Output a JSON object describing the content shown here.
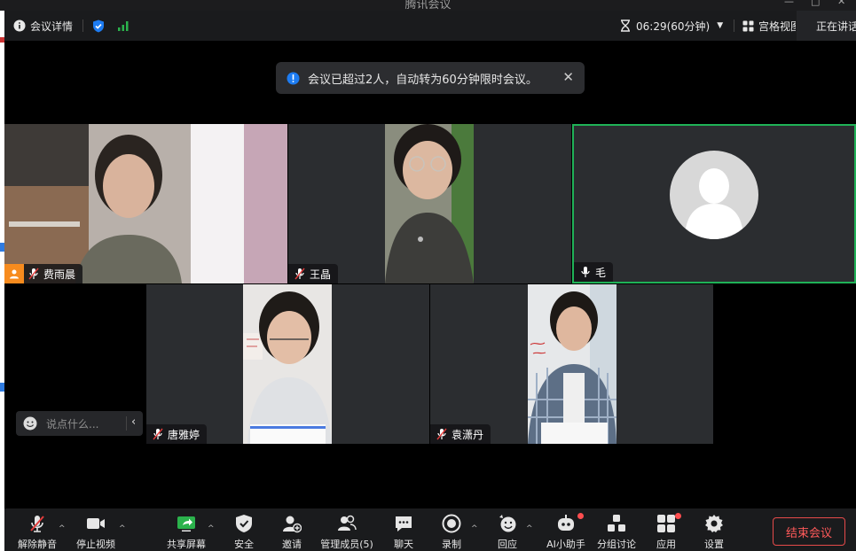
{
  "window": {
    "title": "腾讯会议"
  },
  "topbar": {
    "meeting_info_label": "会议详情",
    "timer": "06:29(60分钟)",
    "layout_label": "宫格视图",
    "speaking_label": "正在讲话"
  },
  "notice": {
    "text": "会议已超过2人，自动转为60分钟限时会议。"
  },
  "participants": [
    {
      "name": "费雨晨",
      "mic": "muted",
      "host": true
    },
    {
      "name": "王晶",
      "mic": "muted"
    },
    {
      "name": "毛",
      "mic": "on",
      "active_speaker": true,
      "video": "off"
    },
    {
      "name": "唐雅婷",
      "mic": "muted"
    },
    {
      "name": "袁潇丹",
      "mic": "muted"
    }
  ],
  "chat": {
    "placeholder": "说点什么..."
  },
  "toolbar": {
    "unmute": "解除静音",
    "stop_video": "停止视频",
    "share_screen": "共享屏幕",
    "security": "安全",
    "invite": "邀请",
    "manage_members": "管理成员(5)",
    "chat": "聊天",
    "record": "录制",
    "reactions": "回应",
    "ai_assistant": "AI小助手",
    "breakout": "分组讨论",
    "apps": "应用",
    "settings": "设置",
    "end_meeting": "结束会议"
  },
  "colors": {
    "active_speaker_border": "#1fb257",
    "end_button": "#e64a4a",
    "accent_blue": "#1d7cf2",
    "notify_dot": "#ff4d4f"
  }
}
